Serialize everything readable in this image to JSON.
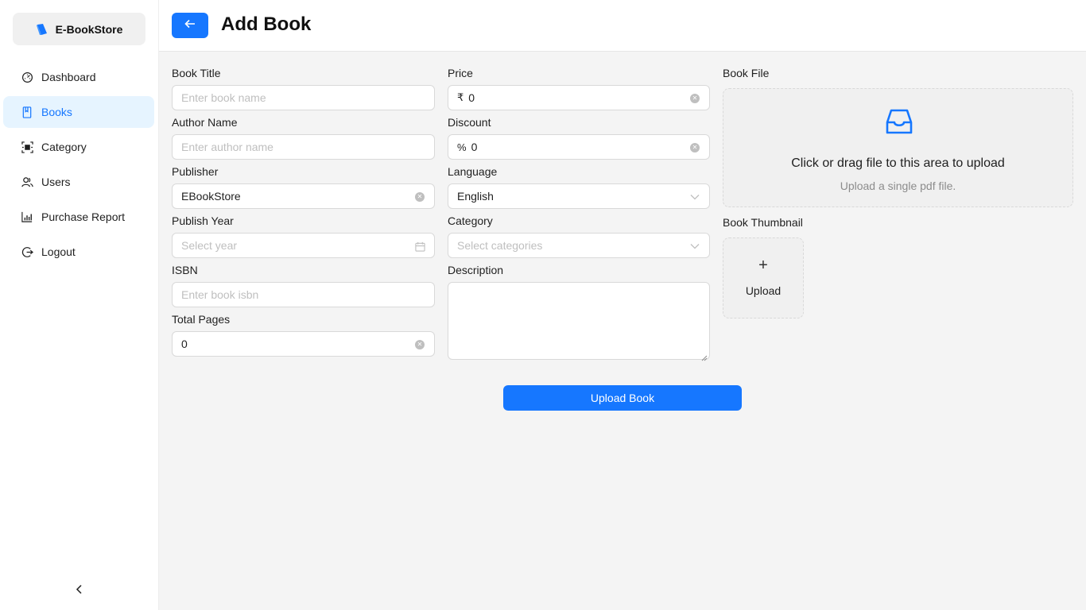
{
  "brand": {
    "name": "E-BookStore",
    "icon": "book-icon"
  },
  "sidebar": {
    "items": [
      {
        "label": "Dashboard",
        "icon": "dashboard-icon",
        "active": false
      },
      {
        "label": "Books",
        "icon": "book-icon",
        "active": true
      },
      {
        "label": "Category",
        "icon": "category-icon",
        "active": false
      },
      {
        "label": "Users",
        "icon": "users-icon",
        "active": false
      },
      {
        "label": "Purchase Report",
        "icon": "bar-chart-icon",
        "active": false
      },
      {
        "label": "Logout",
        "icon": "logout-icon",
        "active": false
      }
    ],
    "collapse_icon": "chevron-left-icon"
  },
  "header": {
    "title": "Add Book",
    "back_icon": "arrow-left-icon"
  },
  "form": {
    "book_title": {
      "label": "Book Title",
      "placeholder": "Enter book name",
      "value": ""
    },
    "author_name": {
      "label": "Author Name",
      "placeholder": "Enter author name",
      "value": ""
    },
    "publisher": {
      "label": "Publisher",
      "value": "EBookStore"
    },
    "publish_year": {
      "label": "Publish Year",
      "placeholder": "Select year",
      "value": ""
    },
    "isbn": {
      "label": "ISBN",
      "placeholder": "Enter book isbn",
      "value": ""
    },
    "total_pages": {
      "label": "Total Pages",
      "value": "0"
    },
    "price": {
      "label": "Price",
      "prefix": "₹",
      "value": "0"
    },
    "discount": {
      "label": "Discount",
      "prefix": "%",
      "value": "0"
    },
    "language": {
      "label": "Language",
      "value": "English"
    },
    "category": {
      "label": "Category",
      "placeholder": "Select categories",
      "value": ""
    },
    "description": {
      "label": "Description",
      "value": ""
    },
    "book_file": {
      "label": "Book File",
      "upload_text": "Click or drag file to this area to upload",
      "hint": "Upload a single pdf file.",
      "icon": "inbox-icon"
    },
    "book_thumbnail": {
      "label": "Book Thumbnail",
      "button_text": "Upload",
      "icon": "plus-icon"
    },
    "submit_label": "Upload Book"
  },
  "colors": {
    "primary": "#1677ff",
    "active_bg": "#e6f4ff",
    "page_bg": "#f4f4f4"
  }
}
